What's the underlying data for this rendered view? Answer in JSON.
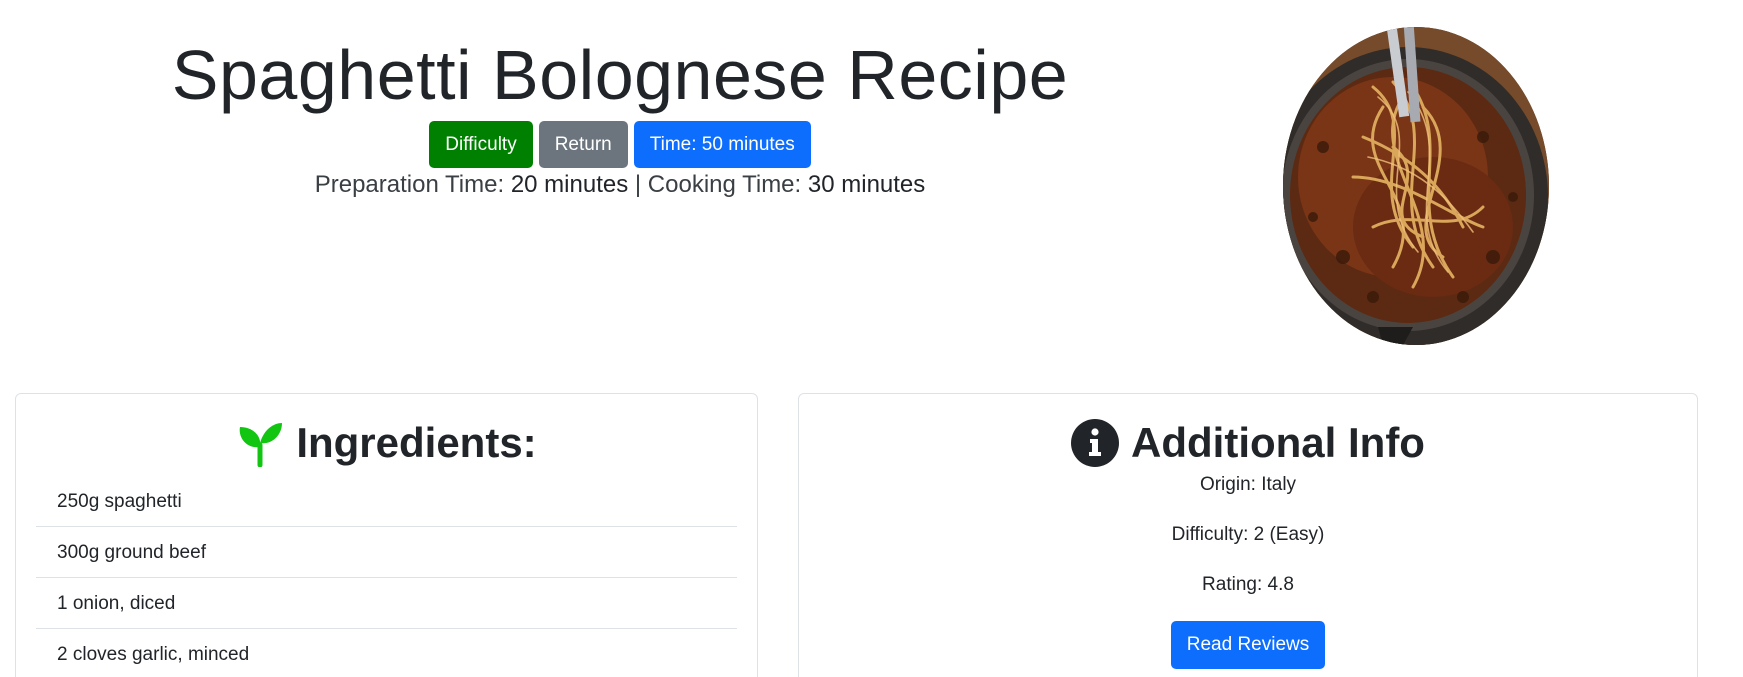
{
  "header": {
    "title": "Spaghetti Bolognese Recipe",
    "buttons": {
      "difficulty": "Difficulty",
      "return": "Return",
      "time": "Time: 50 minutes"
    },
    "times": {
      "prep_label": "Preparation Time:",
      "prep_value": "20 minutes",
      "separator": "|",
      "cook_label": "Cooking Time:",
      "cook_value": "30 minutes"
    }
  },
  "image": {
    "subject": "spaghetti bolognese in a pan",
    "icon": "dish-photo"
  },
  "ingredients": {
    "icon": "sprout-icon",
    "title": "Ingredients:",
    "items": [
      "250g spaghetti",
      "300g ground beef",
      "1 onion, diced",
      "2 cloves garlic, minced"
    ]
  },
  "info": {
    "icon": "info-circle-icon",
    "title": "Additional Info",
    "origin": "Origin: Italy",
    "difficulty": "Difficulty: 2 (Easy)",
    "rating": "Rating: 4.8",
    "reviews_button": "Read Reviews"
  },
  "colors": {
    "green": "#008000",
    "gray": "#6c757d",
    "blue": "#0d6efd",
    "sprout": "#11c511"
  }
}
